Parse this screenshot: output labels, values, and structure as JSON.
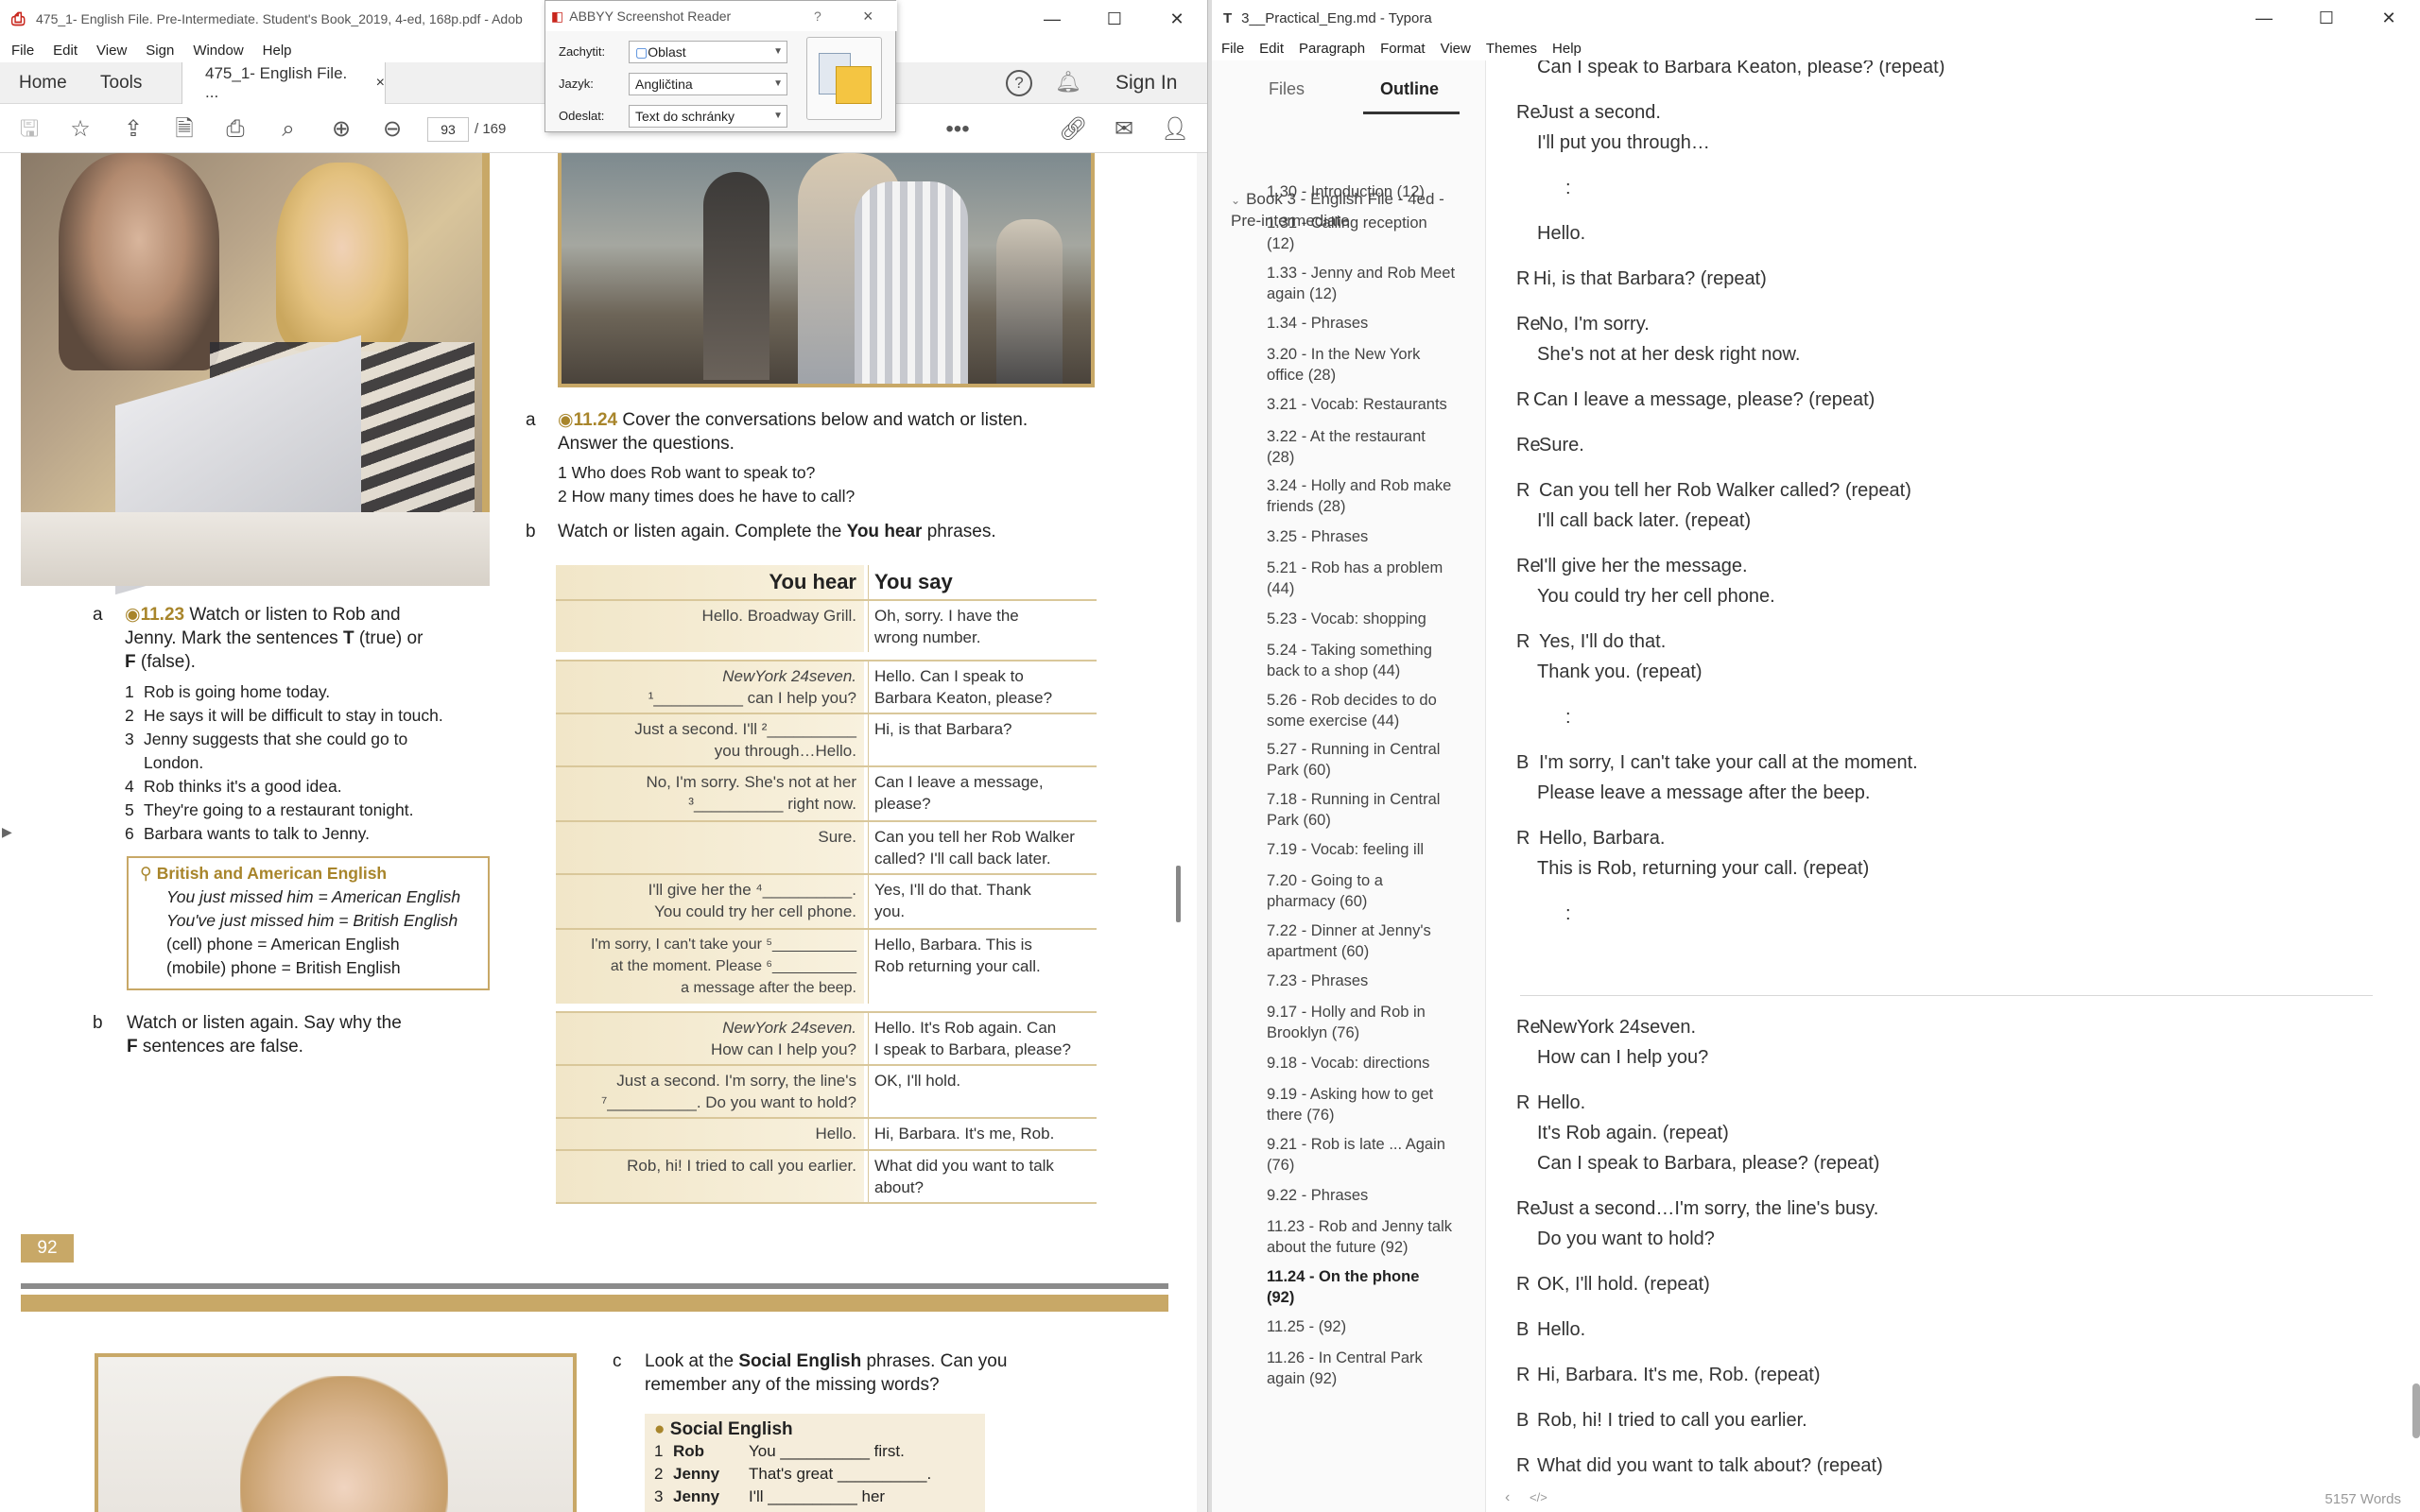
{
  "adobe": {
    "title": "475_1- English File. Pre-Intermediate. Student's Book_2019, 4-ed, 168p.pdf - Adob",
    "menu": [
      "File",
      "Edit",
      "View",
      "Sign",
      "Window",
      "Help"
    ],
    "tabs": {
      "home": "Home",
      "tools": "Tools",
      "doc": "475_1- English File. ...",
      "close": "×"
    },
    "sign_in": "Sign In",
    "page_current": "93",
    "page_total": "/  169",
    "page": {
      "q_a_num": "a",
      "q_a_code": "11.23",
      "q_a_text_1": "Watch or listen to Rob and",
      "q_a_text_2": "Jenny. Mark the sentences",
      "q_a_t": "T",
      "q_a_text_3": "(true) or",
      "q_a_f": "F",
      "q_a_text_4": "(false).",
      "sentences": [
        {
          "n": "1",
          "t": "Rob is going home today."
        },
        {
          "n": "2",
          "t": "He says it will be difficult to stay in touch."
        },
        {
          "n": "3",
          "t": "Jenny suggests that she could go to"
        },
        {
          "n": "",
          "t": "London."
        },
        {
          "n": "4",
          "t": "Rob thinks it's a good idea."
        },
        {
          "n": "5",
          "t": "They're going to a restaurant tonight."
        },
        {
          "n": "6",
          "t": "Barbara wants to talk to Jenny."
        }
      ],
      "bae_title": "British and American English",
      "bae_lines": [
        "You just missed him = American English",
        "You've just missed him = British English",
        "(cell) phone = American English",
        "(mobile) phone = British English"
      ],
      "q_b_num": "b",
      "q_b_text_1": "Watch or listen again. Say why the",
      "q_b_f": "F",
      "q_b_text_2": "sentences are false.",
      "page_number": "92",
      "r_a_num": "a",
      "r_a_code": "11.24",
      "r_a_text_1": "Cover the conversations below and watch or listen.",
      "r_a_text_2": "Answer the questions.",
      "r_q1": "1  Who does Rob want to speak to?",
      "r_q2": "2  How many times does he have to call?",
      "r_b_num": "b",
      "r_b_text": "Watch or listen again. Complete the",
      "r_b_bold": "You hear",
      "r_b_text_2": "phrases.",
      "col_hear": "You hear",
      "col_say": "You say",
      "rows": [
        {
          "hear": [
            "Hello. Broadway Grill."
          ],
          "say": [
            "Oh, sorry. I have the",
            "wrong number."
          ]
        },
        {
          "hear": [
            "NewYork 24seven.",
            "¹__________ can I help you?"
          ],
          "say": [
            "Hello. Can I speak to",
            "Barbara Keaton, please?"
          ]
        },
        {
          "hear": [
            "Just a second. I'll ²__________",
            "you through…Hello."
          ],
          "say": [
            "Hi, is that Barbara?"
          ]
        },
        {
          "hear": [
            "No, I'm sorry. She's not at her",
            "³__________ right now."
          ],
          "say": [
            "Can I leave a message,",
            "please?"
          ]
        },
        {
          "hear": [
            "Sure."
          ],
          "say": [
            "Can you tell her Rob Walker",
            "called? I'll call back later."
          ]
        },
        {
          "hear": [
            "I'll give her the ⁴__________.",
            "You could try her cell phone."
          ],
          "say": [
            "Yes, I'll do that. Thank",
            "you."
          ]
        },
        {
          "hear": [
            "I'm sorry, I can't take your ⁵__________",
            "at the moment. Please ⁶__________",
            "a message after the beep."
          ],
          "say": [
            "Hello, Barbara. This is",
            "Rob returning your call."
          ]
        },
        {
          "hear": [
            "NewYork 24seven.",
            "How can I help you?"
          ],
          "say": [
            "Hello. It's Rob again. Can",
            "I speak to Barbara, please?"
          ]
        },
        {
          "hear": [
            "Just a second. I'm sorry, the line's",
            "⁷__________. Do you want to hold?"
          ],
          "say": [
            "OK, I'll hold."
          ]
        },
        {
          "hear": [
            "Hello."
          ],
          "say": [
            "Hi, Barbara. It's me, Rob."
          ]
        },
        {
          "hear": [
            "Rob, hi! I tried to call you earlier."
          ],
          "say": [
            "What did you want to talk",
            "about?"
          ]
        }
      ],
      "c_num": "c",
      "c_text_1": "Look at the",
      "c_bold": "Social English",
      "c_text_2": "phrases. Can you",
      "c_text_3": "remember any of the missing words?",
      "se_title": "Social English",
      "se_lines": [
        {
          "n": "1",
          "who": "Rob",
          "t": "You __________ first."
        },
        {
          "n": "2",
          "who": "Jenny",
          "t": "That's great __________."
        },
        {
          "n": "3",
          "who": "Jenny",
          "t": "I'll __________ her"
        }
      ]
    }
  },
  "abbyy": {
    "title": "ABBYY Screenshot Reader",
    "help": "?",
    "close": "×",
    "capture_label": "Zachytit:",
    "capture_value": "Oblast",
    "language_label": "Jazyk:",
    "language_value": "Angličtina",
    "send_label": "Odeslat:",
    "send_value": "Text do schránky"
  },
  "typora": {
    "title": "3__Practical_Eng.md - Typora",
    "menu": [
      "File",
      "Edit",
      "Paragraph",
      "Format",
      "View",
      "Themes",
      "Help"
    ],
    "tab_files": "Files",
    "tab_outline": "Outline",
    "outline_root": "Book 3 - English File - 4ed - Pre-intermediate",
    "outline": [
      [
        "1.30 - Introduction (12)"
      ],
      [
        "1.31 - Calling reception",
        "(12)"
      ],
      [
        "1.33 - Jenny and Rob Meet",
        "again (12)"
      ],
      [
        "1.34 - Phrases"
      ],
      [
        "3.20 - In the New York",
        "office (28)"
      ],
      [
        "3.21 - Vocab: Restaurants"
      ],
      [
        "3.22 - At the restaurant",
        "(28)"
      ],
      [
        "3.24 - Holly and Rob make",
        "friends (28)"
      ],
      [
        "3.25 - Phrases"
      ],
      [
        "5.21 - Rob has a problem",
        "(44)"
      ],
      [
        "5.23 - Vocab: shopping"
      ],
      [
        "5.24 - Taking something",
        "back to a shop (44)"
      ],
      [
        "5.26 - Rob decides to do",
        "some exercise (44)"
      ],
      [
        "5.27 - Running in Central",
        "Park (60)"
      ],
      [
        "7.18 - Running in Central",
        "Park (60)"
      ],
      [
        "7.19 - Vocab: feeling ill"
      ],
      [
        "7.20 - Going to a",
        "pharmacy (60)"
      ],
      [
        "7.22 - Dinner at Jenny's",
        "apartment (60)"
      ],
      [
        "7.23 - Phrases"
      ],
      [
        "9.17 - Holly and Rob in",
        "Brooklyn (76)"
      ],
      [
        "9.18 - Vocab: directions"
      ],
      [
        "9.19 - Asking how to get",
        "there (76)"
      ],
      [
        "9.21 - Rob is late ... Again",
        "(76)"
      ],
      [
        "9.22 - Phrases"
      ],
      [
        "11.23 - Rob and Jenny talk",
        "about the future (92)"
      ],
      [
        "11.24 - On the phone",
        "(92)"
      ],
      [
        "11.25 - (92)"
      ],
      [
        "11.26 - In Central Park",
        "again (92)"
      ]
    ],
    "editor_lines": [
      {
        "s": "",
        "t": "Can I speak to Barbara Keaton, please? (repeat)"
      },
      {
        "s": "Re",
        "t": "Just a second."
      },
      {
        "s": "",
        "t": "I'll put you through…"
      },
      {
        "s": "",
        "t": ":"
      },
      {
        "s": "",
        "t": "Hello."
      },
      {
        "s": "R",
        "t": "Hi, is that Barbara? (repeat)"
      },
      {
        "s": "Re",
        "t": "No, I'm sorry."
      },
      {
        "s": "",
        "t": "She's not at her desk right now."
      },
      {
        "s": "R",
        "t": "Can I leave a message, please? (repeat)"
      },
      {
        "s": "Re",
        "t": "Sure."
      },
      {
        "s": "R",
        "t": "Can you tell her Rob Walker called? (repeat)"
      },
      {
        "s": "",
        "t": "I'll call back later. (repeat)"
      },
      {
        "s": "Re",
        "t": "I'll give her the message."
      },
      {
        "s": "",
        "t": "You could try her cell phone."
      },
      {
        "s": "R",
        "t": "Yes, I'll do that."
      },
      {
        "s": "",
        "t": "Thank you. (repeat)"
      },
      {
        "s": "",
        "t": ":"
      },
      {
        "s": "B",
        "t": "I'm sorry, I can't take your call at the moment."
      },
      {
        "s": "",
        "t": "Please leave a message after the beep."
      },
      {
        "s": "R",
        "t": "Hello, Barbara."
      },
      {
        "s": "",
        "t": "This is Rob, returning your call. (repeat)"
      },
      {
        "s": "",
        "t": ":"
      },
      {
        "s": "Re",
        "t": "NewYork 24seven."
      },
      {
        "s": "",
        "t": "How can I help you?"
      },
      {
        "s": "R",
        "t": "Hello."
      },
      {
        "s": "",
        "t": "It's Rob again. (repeat)"
      },
      {
        "s": "",
        "t": "Can I speak to Barbara, please? (repeat)"
      },
      {
        "s": "Re",
        "t": "Just a second…I'm sorry, the line's busy."
      },
      {
        "s": "",
        "t": "Do you want to hold?"
      },
      {
        "s": "R",
        "t": "OK, I'll hold. (repeat)"
      },
      {
        "s": "B",
        "t": "Hello."
      },
      {
        "s": "R",
        "t": "Hi, Barbara. It's me, Rob. (repeat)"
      },
      {
        "s": "B",
        "t": "Rob, hi! I tried to call you earlier."
      },
      {
        "s": "R",
        "t": "What did you want to talk about? (repeat)"
      }
    ],
    "word_count": "5157 Words"
  }
}
